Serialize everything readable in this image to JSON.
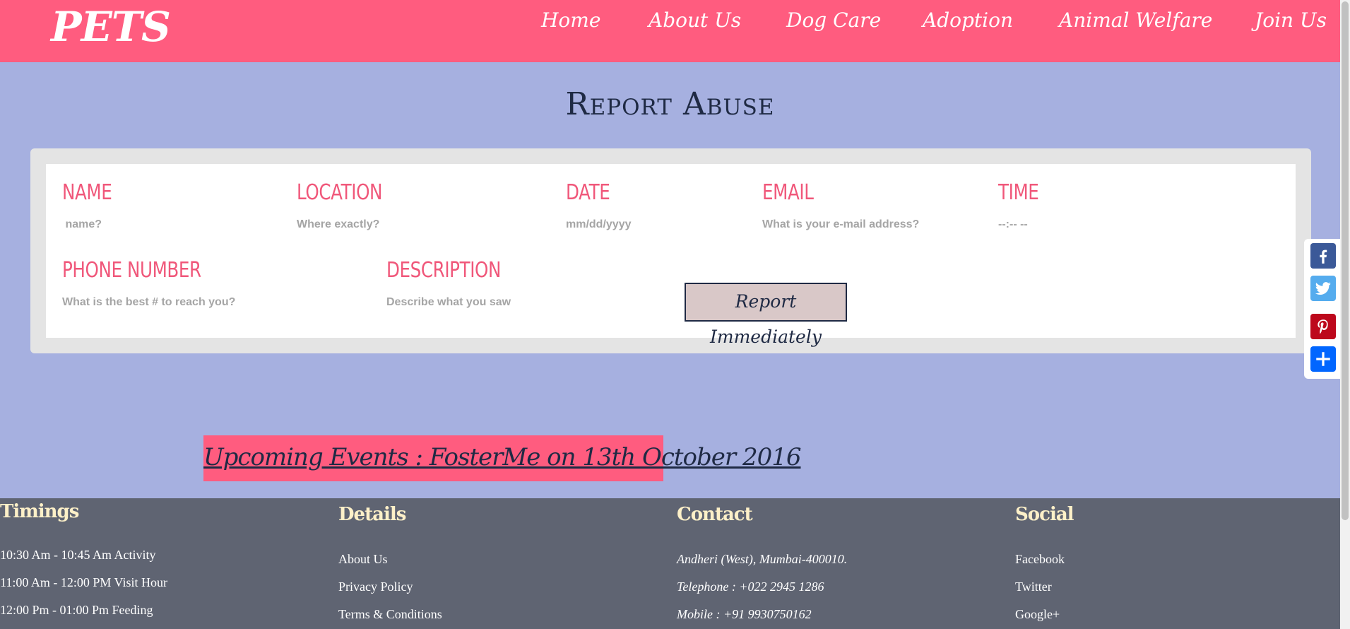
{
  "header": {
    "logo": "PETS",
    "nav": [
      "Home",
      "About Us",
      "Dog Care",
      "Adoption",
      "Animal Welfare",
      "Join Us"
    ]
  },
  "page": {
    "title": "Report Abuse"
  },
  "form": {
    "name_label": "NAME",
    "name_placeholder": " name?",
    "location_label": "LOCATION",
    "location_placeholder": "Where exactly?",
    "date_label": "DATE",
    "date_placeholder": "mm/dd/yyyy",
    "email_label": "EMAIL",
    "email_placeholder": "What is your e-mail address?",
    "time_label": "TIME",
    "time_placeholder": "--:-- --",
    "phone_label": "PHONE NUMBER",
    "phone_placeholder": "What is the best # to reach you?",
    "description_label": "DESCRIPTION",
    "description_placeholder": "Describe what you saw",
    "submit_label": "Report Immediately"
  },
  "share": {
    "icons": [
      "facebook-icon",
      "twitter-icon",
      "pinterest-icon",
      "share-plus-icon"
    ],
    "colors": {
      "facebook": "#3b5998",
      "twitter": "#55acee",
      "pinterest": "#bd081c",
      "share": "#0166ff"
    }
  },
  "events": {
    "banner": "Upcoming Events : FosterMe on 13th October 2016"
  },
  "footer": {
    "timings": {
      "heading": "Timings",
      "lines": [
        "10:30 Am - 10:45 Am Activity",
        "11:00 Am - 12:00 PM Visit Hour",
        "12:00 Pm - 01:00 Pm Feeding"
      ]
    },
    "details": {
      "heading": "Details",
      "links": [
        "About Us",
        "Privacy Policy",
        "Terms & Conditions"
      ]
    },
    "contact": {
      "heading": "Contact",
      "lines": [
        "Andheri (West), Mumbai-400010.",
        "Telephone : +022 2945 1286",
        "Mobile : +91 9930750162"
      ]
    },
    "social": {
      "heading": "Social",
      "links": [
        "Facebook",
        "Twitter",
        "Google+"
      ]
    }
  },
  "colors": {
    "header_bg": "#ff5c7f",
    "page_bg": "#a6b0e0",
    "label_color": "#f0577a",
    "footer_bg": "#5f6472",
    "footer_heading": "#fdf0c8",
    "title_color": "#1f2a44"
  }
}
